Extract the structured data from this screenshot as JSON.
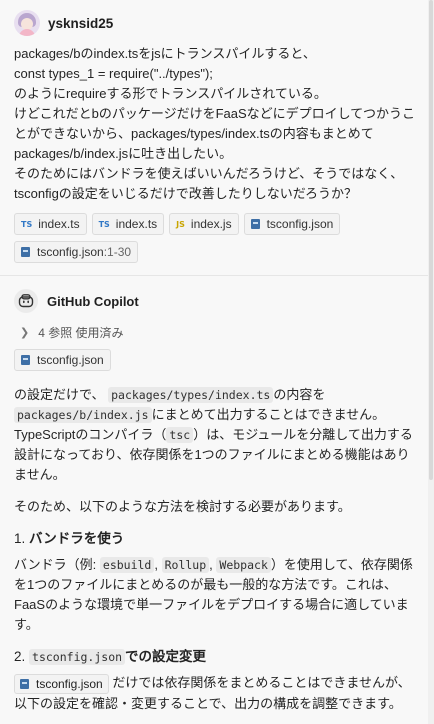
{
  "user": {
    "name": "ysknsid25",
    "message": [
      "packages/bのindex.tsをjsにトランスパイルすると、",
      "const types_1 = require(\"../types\");",
      "のようにrequireする形でトランスパイルされている。",
      "けどこれだとbのパッケージだけをFaaSなどにデプロイしてつかうことができないから、packages/types/index.tsの内容もまとめてpackages/b/index.jsに吐き出したい。",
      "そのためにはバンドラを使えばいいんだろうけど、そうではなく、tsconfigの設定をいじるだけで改善したりしないだろうか？"
    ],
    "attachments": [
      {
        "icon": "TS",
        "label": "index.ts"
      },
      {
        "icon": "TS",
        "label": "index.ts"
      },
      {
        "icon": "JS",
        "label": "index.js"
      },
      {
        "icon": "config",
        "label": "tsconfig.json"
      },
      {
        "icon": "config",
        "label": "tsconfig.json",
        "range": ":1-30"
      }
    ]
  },
  "bot": {
    "name": "GitHub Copilot",
    "refs_label": "4 参照 使用済み",
    "ref_file": "tsconfig.json",
    "p1_a": "の設定だけで、",
    "p1_code1": "packages/types/index.ts",
    "p1_b": "の内容を",
    "p1_code2": "packages/b/index.js",
    "p1_c": "にまとめて出力することはできません。TypeScriptのコンパイラ（",
    "p1_code3": "tsc",
    "p1_d": "）は、モジュールを分離して出力する設計になっており、依存関係を1つのファイルにまとめる機能はありません。",
    "p2": "そのため、以下のような方法を検討する必要があります。",
    "s1_num": "1.",
    "s1_title": "バンドラを使う",
    "s1_a": "バンドラ（例:",
    "s1_code1": "esbuild",
    "s1_sep1": ",",
    "s1_code2": "Rollup",
    "s1_sep2": ",",
    "s1_code3": "Webpack",
    "s1_b": "）を使用して、依存関係を1つのファイルにまとめるのが最も一般的な方法です。これは、FaaSのような環境で単一ファイルをデプロイする場合に適しています。",
    "s2_num": "2.",
    "s2_code": "tsconfig.json",
    "s2_title": "での設定変更",
    "s2_file": "tsconfig.json",
    "s2_text": "だけでは依存関係をまとめることはできませんが、以下の設定を確認・変更することで、出力の構成を調整できます。"
  }
}
